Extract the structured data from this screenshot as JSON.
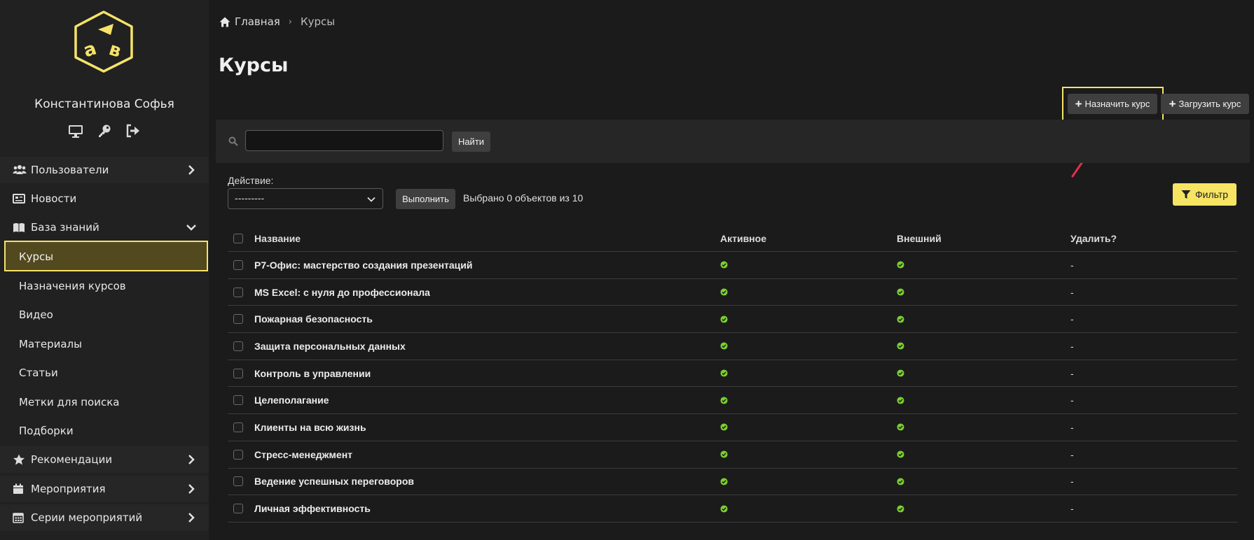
{
  "user": {
    "name": "Константинова Софья"
  },
  "sidebar": {
    "items": [
      {
        "label": "Пользователи",
        "icon": "users-icon",
        "state": "collapsed"
      },
      {
        "label": "Новости",
        "icon": "newspaper-icon",
        "state": "link"
      },
      {
        "label": "База знаний",
        "icon": "book-icon",
        "state": "expanded"
      },
      {
        "label": "Курсы",
        "state": "active"
      },
      {
        "label": "Назначения курсов"
      },
      {
        "label": "Видео"
      },
      {
        "label": "Материалы"
      },
      {
        "label": "Статьи"
      },
      {
        "label": "Метки для поиска"
      },
      {
        "label": "Подборки"
      },
      {
        "label": "Рекомендации",
        "icon": "star-icon",
        "state": "collapsed"
      },
      {
        "label": "Мероприятия",
        "icon": "calendar-icon",
        "state": "collapsed"
      },
      {
        "label": "Серии мероприятий",
        "icon": "calendar-grid-icon",
        "state": "collapsed"
      }
    ]
  },
  "breadcrumb": {
    "home": "Главная",
    "current": "Курсы"
  },
  "page": {
    "title": "Курсы"
  },
  "toolbar": {
    "assign_label": "Назначить курс",
    "upload_label": "Загрузить курс"
  },
  "search": {
    "value": "",
    "button": "Найти"
  },
  "actions": {
    "label": "Действие:",
    "select_value": "---------",
    "run_button": "Выполнить",
    "selected_text": "Выбрано 0 объектов из 10",
    "filter_button": "Фильтр"
  },
  "table": {
    "headers": [
      "Название",
      "Активное",
      "Внешний",
      "Удалить?"
    ],
    "rows": [
      {
        "name": "Р7-Офис: мастерство создания презентаций",
        "active": true,
        "external": true,
        "delete": "-"
      },
      {
        "name": "MS Excel: с нуля до профессионала",
        "active": true,
        "external": true,
        "delete": "-"
      },
      {
        "name": "Пожарная безопасность",
        "active": true,
        "external": true,
        "delete": "-"
      },
      {
        "name": "Защита персональных данных",
        "active": true,
        "external": true,
        "delete": "-"
      },
      {
        "name": "Контроль в управлении",
        "active": true,
        "external": true,
        "delete": "-"
      },
      {
        "name": "Целеполагание",
        "active": true,
        "external": true,
        "delete": "-"
      },
      {
        "name": "Клиенты на всю жизнь",
        "active": true,
        "external": true,
        "delete": "-"
      },
      {
        "name": "Стресс-менеджмент",
        "active": true,
        "external": true,
        "delete": "-"
      },
      {
        "name": "Ведение успешных переговоров",
        "active": true,
        "external": true,
        "delete": "-"
      },
      {
        "name": "Личная эффективность",
        "active": true,
        "external": true,
        "delete": "-"
      }
    ]
  },
  "colors": {
    "accent": "#f7e463",
    "check": "#7ccf2f",
    "highlight_border": "#f5e36a",
    "arrow": "#e0304d"
  }
}
